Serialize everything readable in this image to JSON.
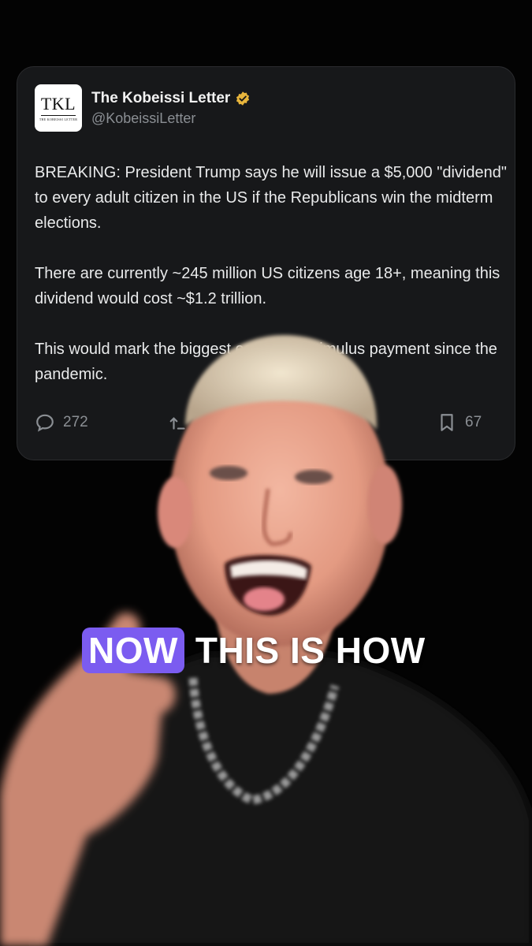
{
  "tweet": {
    "avatar_monogram": "TKL",
    "avatar_subtitle": "THE KOBEISSI LETTER",
    "name": "The Kobeissi Letter",
    "handle": "@KobeissiLetter",
    "paragraphs": [
      "BREAKING: President Trump says he will issue a $5,000 \"dividend\" to every adult citizen in the US if the Republicans win the midterm elections.",
      "There are currently ~245 million US citizens age 18+, meaning this dividend would cost ~$1.2 trillion.",
      "This would mark the biggest economic stimulus payment since the pandemic."
    ],
    "replies": "272",
    "bookmarks": "67",
    "icons": {
      "reply": "reply-icon",
      "retweet": "retweet-icon",
      "bookmark": "bookmark-icon",
      "verified": "verified-badge-icon"
    },
    "verified_color": "#e8b53c"
  },
  "caption": {
    "highlight": "NOW",
    "rest": "THIS IS HOW",
    "highlight_color": "#7b5cf0"
  }
}
